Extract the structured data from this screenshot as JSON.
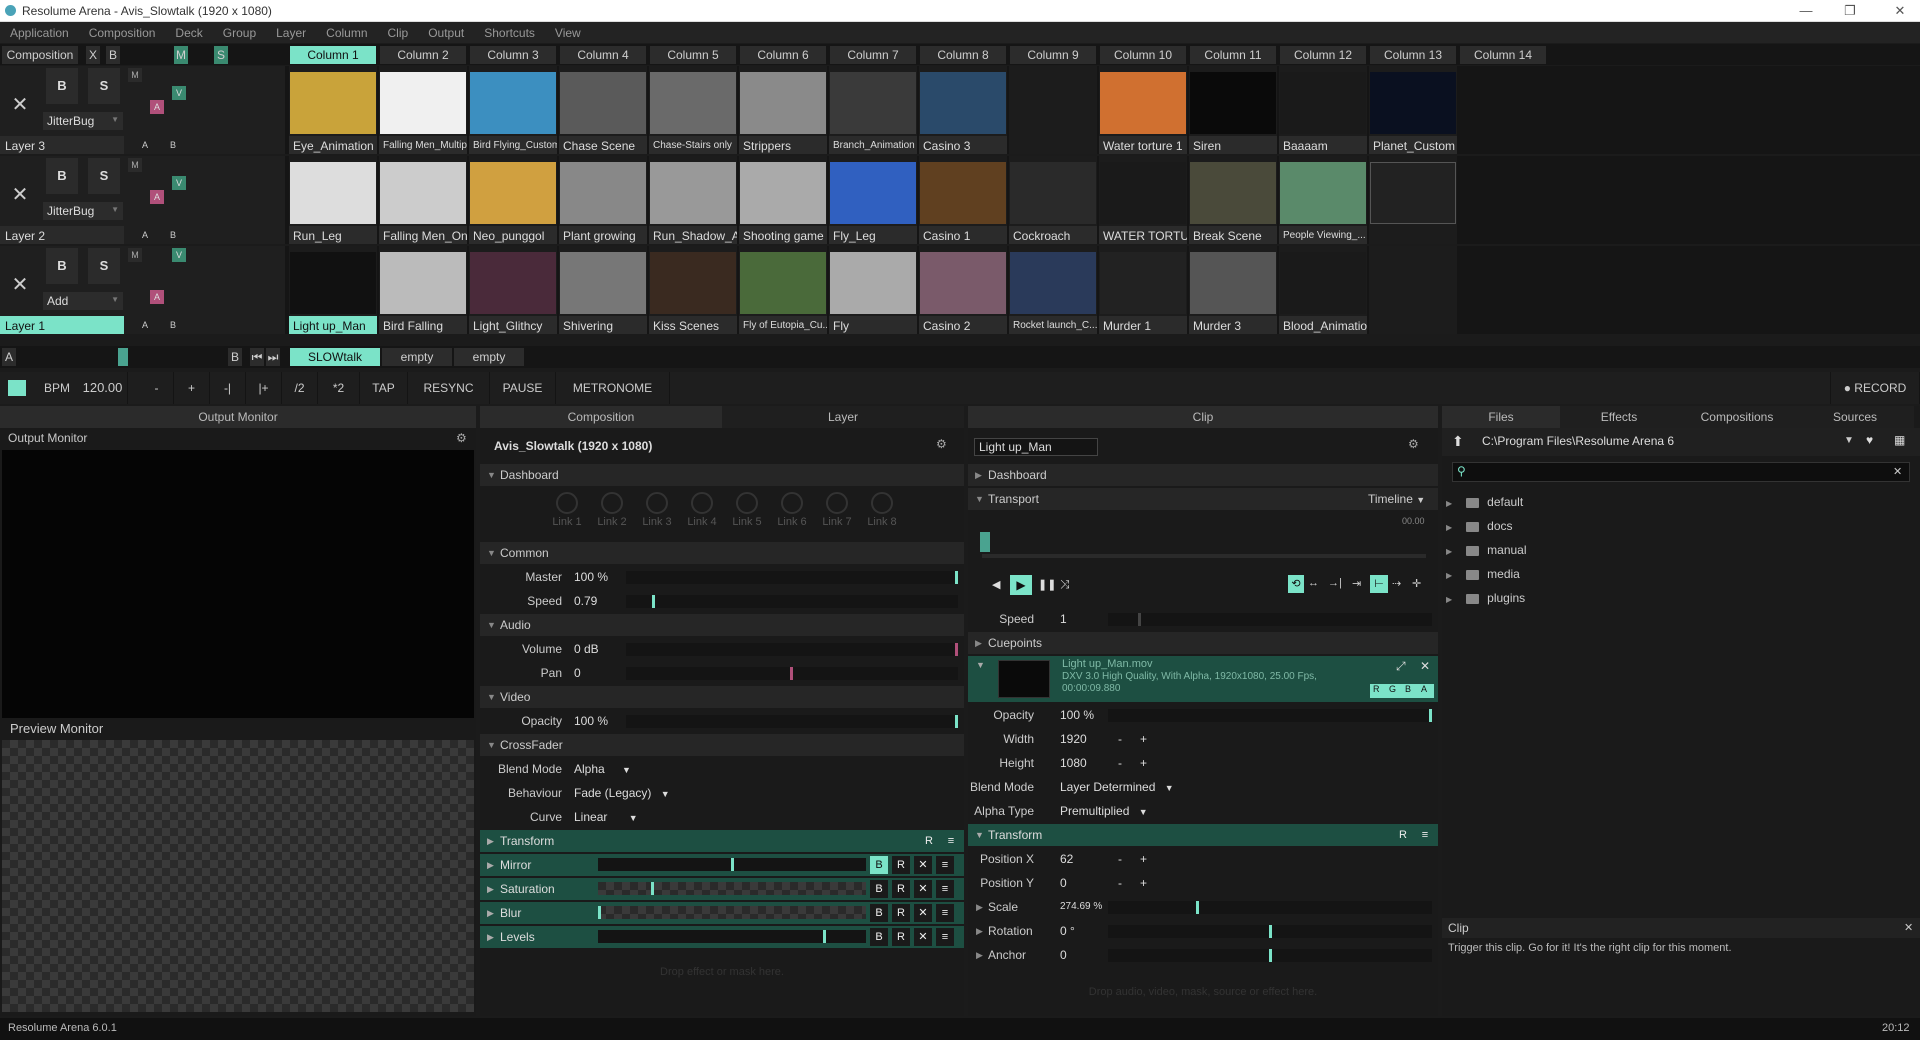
{
  "window": {
    "title": "Resolume Arena - Avis_Slowtalk (1920 x 1080)"
  },
  "menu": [
    "Application",
    "Composition",
    "Deck",
    "Group",
    "Layer",
    "Column",
    "Clip",
    "Output",
    "Shortcuts",
    "View"
  ],
  "comp_bar": {
    "label": "Composition",
    "x": "X",
    "b": "B",
    "m": "M",
    "s": "S"
  },
  "columns": [
    "Column 1",
    "Column 2",
    "Column 3",
    "Column 4",
    "Column 5",
    "Column 6",
    "Column 7",
    "Column 8",
    "Column 9",
    "Column 10",
    "Column 11",
    "Column 12",
    "Column 13",
    "Column 14"
  ],
  "layers": [
    {
      "name": "Layer 3",
      "effect": "JitterBug",
      "clips": [
        "Eye_Animation",
        "Falling Men_Multiple",
        "Bird Flying_Custom",
        "Chase Scene",
        "Chase-Stairs only",
        "Strippers",
        "Branch_Animation",
        "Casino 3",
        "",
        "Water torture 1",
        "Siren",
        "Baaaam",
        "Planet_Custom"
      ]
    },
    {
      "name": "Layer 2",
      "effect": "JitterBug",
      "clips": [
        "Run_Leg",
        "Falling Men_One",
        "Neo_punggol",
        "Plant growing",
        "Run_Shadow_Ani",
        "Shooting game",
        "Fly_Leg",
        "Casino 1",
        "Cockroach",
        "WATER TORTURE",
        "Break Scene",
        "People Viewing_...",
        ""
      ]
    },
    {
      "name": "Layer 1",
      "effect": "Add",
      "clips": [
        "Light up_Man",
        "Bird Falling",
        "Light_Glithcy",
        "Shivering",
        "Kiss Scenes",
        "Fly of Eutopia_Cu...",
        "Fly",
        "Casino 2",
        "Rocket launch_C...",
        "Murder 1",
        "Murder 3",
        "Blood_Animation",
        ""
      ]
    }
  ],
  "layer_buttons": {
    "b": "B",
    "s": "S",
    "m": "M",
    "v": "V",
    "a": "A",
    "x": "✕"
  },
  "deck": {
    "a": "A",
    "b": "B",
    "decks": [
      "SLOWtalk",
      "empty",
      "empty"
    ]
  },
  "transport": {
    "bpm_label": "BPM",
    "bpm": "120.00",
    "minus": "-",
    "plus": "+",
    "nudge_l": "-|",
    "nudge_r": "|+",
    "half": "/2",
    "double": "*2",
    "tap": "TAP",
    "resync": "RESYNC",
    "pause": "PAUSE",
    "metronome": "METRONOME",
    "record": "RECORD"
  },
  "output_panel": {
    "header": "Output Monitor",
    "output_label": "Output Monitor",
    "preview_label": "Preview Monitor"
  },
  "layer_panel": {
    "tabs": [
      "Composition",
      "Layer"
    ],
    "title": "Avis_Slowtalk (1920 x 1080)",
    "dashboard": "Dashboard",
    "links": [
      "Link 1",
      "Link 2",
      "Link 3",
      "Link 4",
      "Link 5",
      "Link 6",
      "Link 7",
      "Link 8"
    ],
    "common": "Common",
    "master_k": "Master",
    "master_v": "100 %",
    "master_level": 1.0,
    "speed_k": "Speed",
    "speed_v": "0.79",
    "speed_level": 0.08,
    "audio": "Audio",
    "volume_k": "Volume",
    "volume_v": "0 dB",
    "pan_k": "Pan",
    "pan_v": "0",
    "video": "Video",
    "opacity_k": "Opacity",
    "opacity_v": "100 %",
    "crossfader": "CrossFader",
    "blend_k": "Blend Mode",
    "blend_v": "Alpha",
    "behaviour_k": "Behaviour",
    "behaviour_v": "Fade (Legacy)",
    "curve_k": "Curve",
    "curve_v": "Linear",
    "transform": "Transform",
    "effects": [
      "Mirror",
      "Saturation",
      "Blur",
      "Levels"
    ],
    "fx_b": "B",
    "fx_r": "R",
    "fx_x": "✕",
    "fx_menu": "≡",
    "drop": "Drop effect or mask here."
  },
  "clip_panel": {
    "header": "Clip",
    "name": "Light up_Man",
    "dashboard": "Dashboard",
    "transport": "Transport",
    "timeline": "Timeline",
    "time": "00.00",
    "speed_k": "Speed",
    "speed_v": "1",
    "cuepoints": "Cuepoints",
    "file": "Light up_Man.mov",
    "info1": "DXV 3.0 High Quality, With Alpha, 1920x1080, 25.00 Fps,",
    "info2": "00:00:09.880",
    "rgba": [
      "R",
      "G",
      "B",
      "A"
    ],
    "opacity_k": "Opacity",
    "opacity_v": "100 %",
    "width_k": "Width",
    "width_v": "1920",
    "height_k": "Height",
    "height_v": "1080",
    "blend_k": "Blend Mode",
    "blend_v": "Layer Determined",
    "alpha_k": "Alpha Type",
    "alpha_v": "Premultiplied",
    "transform": "Transform",
    "posx_k": "Position X",
    "posx_v": "62",
    "posy_k": "Position Y",
    "posy_v": "0",
    "scale_k": "Scale",
    "scale_v": "274.69 %",
    "rot_k": "Rotation",
    "rot_v": "0 °",
    "anchor_k": "Anchor",
    "anchor_v": "0",
    "drop": "Drop audio, video, mask, source or effect here."
  },
  "browser": {
    "tabs": [
      "Files",
      "Effects",
      "Compositions",
      "Sources"
    ],
    "path": "C:\\Program Files\\Resolume Arena 6",
    "folders": [
      "default",
      "docs",
      "manual",
      "media",
      "plugins"
    ],
    "help_title": "Clip",
    "help_text": "Trigger this clip. Go for it! It's the right clip for this moment."
  },
  "status": {
    "version": "Resolume Arena 6.0.1",
    "time": "20:12"
  },
  "colors": {
    "accent": "#7be3c8",
    "fx_row": "#1d4f42",
    "pink": "#b0507a"
  }
}
